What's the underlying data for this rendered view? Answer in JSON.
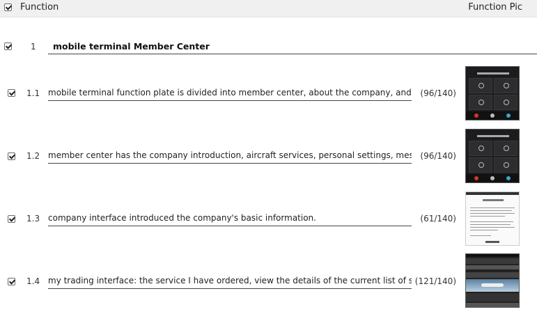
{
  "header": {
    "function_label": "Function",
    "function_pic_label": "Function Pic"
  },
  "section": {
    "number": "1",
    "title": "mobile terminal Member Center"
  },
  "rows": [
    {
      "number": "1.1",
      "text": "mobile terminal function plate is divided into member center, about the company, and now cont",
      "count": "(96/140)",
      "thumbnail": "dark-menu-screenshot"
    },
    {
      "number": "1.2",
      "text": "member center has the company introduction, aircraft services, personal settings, message center",
      "count": "(96/140)",
      "thumbnail": "dark-menu-screenshot"
    },
    {
      "number": "1.3",
      "text": "company interface introduced the company's basic information.",
      "count": "(61/140)",
      "thumbnail": "text-page-screenshot"
    },
    {
      "number": "1.4",
      "text": "my trading interface: the service I have ordered, view the details of the current list of services, ap",
      "count": "(121/140)",
      "thumbnail": "aircraft-listing-screenshot"
    }
  ],
  "colors": {
    "header_bg": "#f0f0f0",
    "line": "#444444"
  }
}
